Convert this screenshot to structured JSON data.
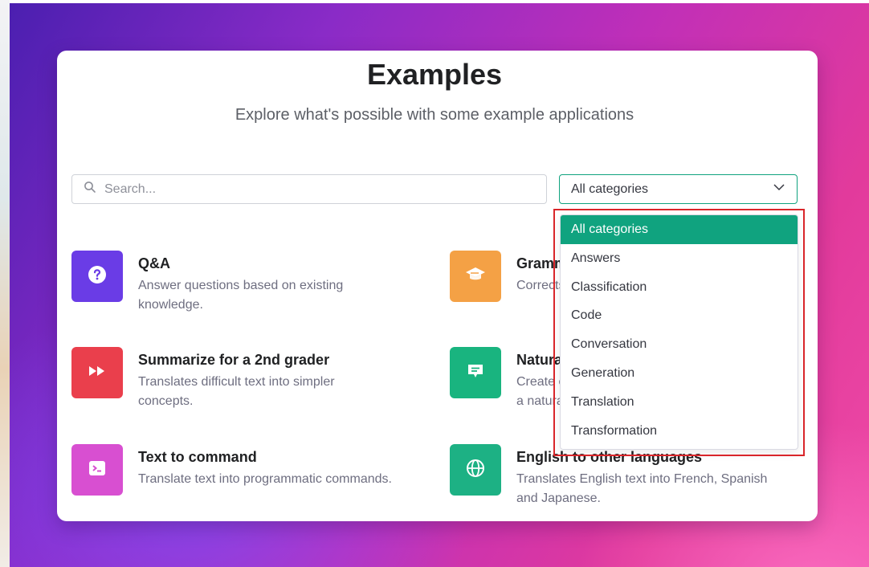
{
  "header": {
    "title": "Examples",
    "subtitle": "Explore what's possible with some example applications"
  },
  "search": {
    "placeholder": "Search...",
    "value": ""
  },
  "category_select": {
    "selected": "All categories",
    "options": [
      "All categories",
      "Answers",
      "Classification",
      "Code",
      "Conversation",
      "Generation",
      "Translation",
      "Transformation"
    ]
  },
  "examples": [
    {
      "title": "Q&A",
      "description_lines": [
        "Answer questions based on existing",
        "knowledge."
      ],
      "icon": "question-icon",
      "color": "#6a3ce6"
    },
    {
      "title": "Grammar correction",
      "description_lines": [
        "Corrects sentences into standard English."
      ],
      "icon": "graduation-cap-icon",
      "color": "#f4a145"
    },
    {
      "title": "Summarize for a 2nd grader",
      "description_lines": [
        "Translates difficult text into simpler",
        "concepts."
      ],
      "icon": "fast-forward-icon",
      "color": "#ea3f4c"
    },
    {
      "title": "Natural language to OpenAI API",
      "description_lines": [
        "Create code to call to the OpenAI API using",
        "a natural language instruction."
      ],
      "icon": "message-icon",
      "color": "#19b47f"
    },
    {
      "title": "Text to command",
      "description_lines": [
        "Translate text into programmatic commands."
      ],
      "icon": "terminal-icon",
      "color": "#d84fd1"
    },
    {
      "title": "English to other languages",
      "description_lines": [
        "Translates English text into French, Spanish",
        "and Japanese."
      ],
      "icon": "globe-icon",
      "color": "#1db184"
    }
  ],
  "colors": {
    "accent": "#10a37f",
    "highlight_box": "#d9262a"
  }
}
